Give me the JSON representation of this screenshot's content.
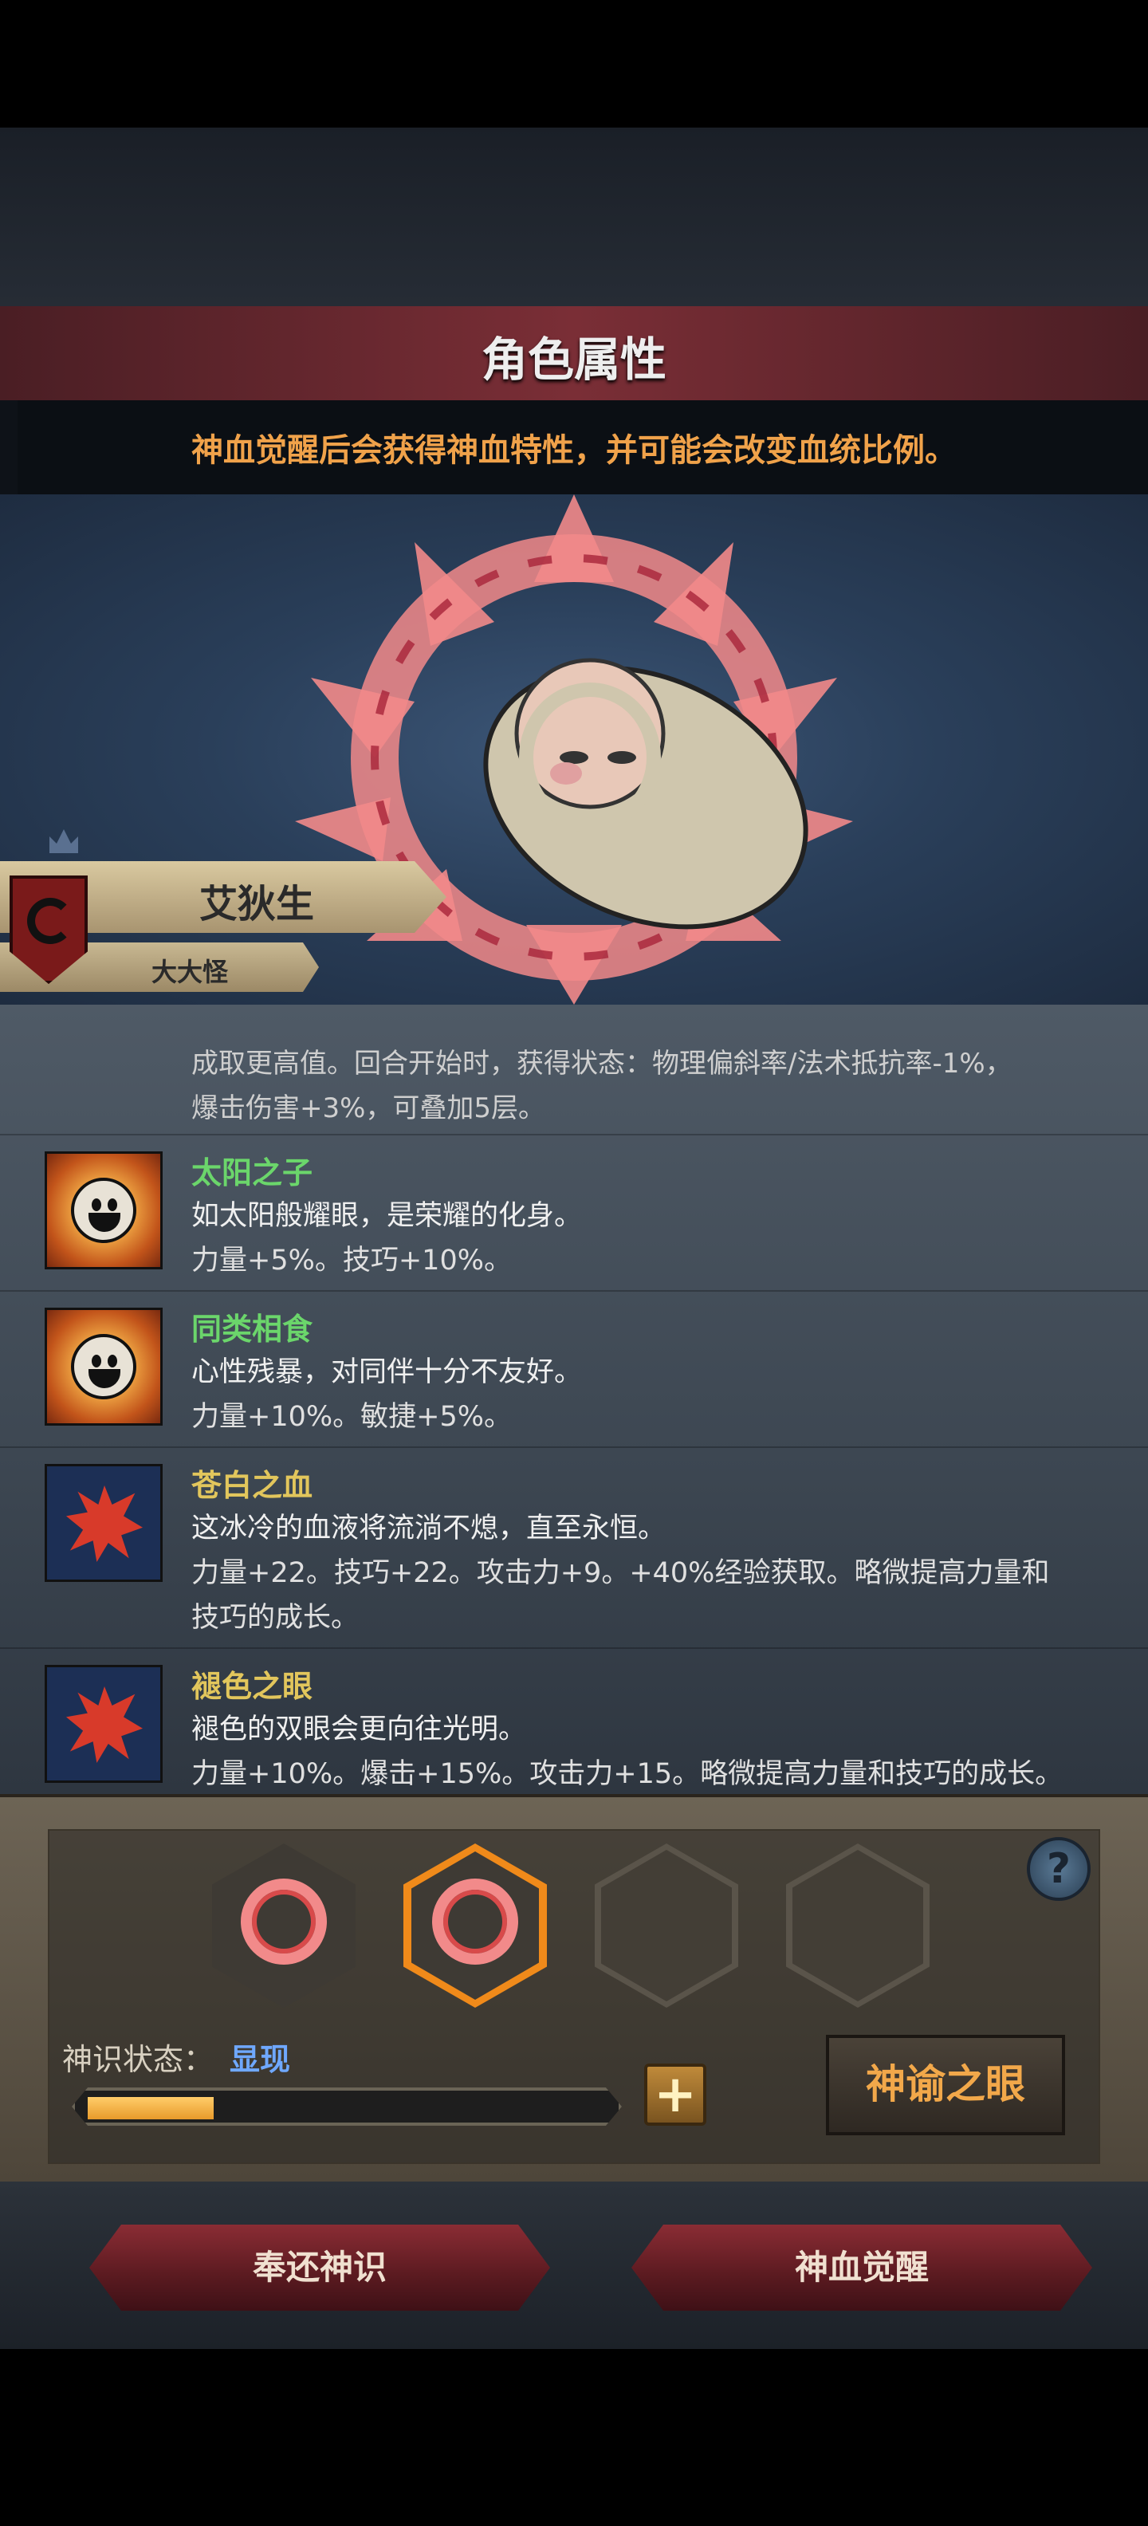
{
  "header": {
    "title": "角色属性"
  },
  "notice": {
    "text": "神血觉醒后会获得神血特性，并可能会改变血统比例。"
  },
  "character": {
    "name": "艾狄生",
    "class": "大大怪"
  },
  "cutoff_trait": {
    "line1": "成取更高值。回合开始时，获得状态：物理偏斜率/法术抵抗率-1%，",
    "line2": "爆击伤害+3%，可叠加5层。"
  },
  "traits": [
    {
      "name": "太阳之子",
      "icon": "smiling-sun-icon",
      "desc": "如太阳般耀眼，是荣耀的化身。",
      "stat1": "力量+5%。技巧+10%。",
      "stat2": ""
    },
    {
      "name": "同类相食",
      "icon": "smiling-sun-icon",
      "desc": "心性残暴，对同伴十分不友好。",
      "stat1": "力量+10%。敏捷+5%。",
      "stat2": ""
    },
    {
      "name": "苍白之血",
      "icon": "blood-splatter-icon",
      "desc": "这冰冷的血液将流淌不熄，直至永恒。",
      "stat1": "力量+22。技巧+22。攻击力+9。+40%经验获取。略微提高力量和",
      "stat2": "技巧的成长。"
    },
    {
      "name": "褪色之眼",
      "icon": "blood-splatter-icon",
      "desc": "褪色的双眼会更向往光明。",
      "stat1": "力量+10%。爆击+15%。攻击力+15。略微提高力量和技巧的成长。",
      "stat2": ""
    }
  ],
  "divine_slots": [
    "filled",
    "active",
    "empty",
    "empty"
  ],
  "status": {
    "label": "神识状态：",
    "value": "显现",
    "progress_fraction": 0.12
  },
  "buttons": {
    "help": "?",
    "plus": "+",
    "oracle": "神谕之眼",
    "return": "奉还神识",
    "awaken": "神血觉醒"
  },
  "colors": {
    "accent_orange": "#f0a24a",
    "name_green": "#6bd66b",
    "name_gold": "#e2c65c",
    "state_blue": "#6fa8ff"
  }
}
